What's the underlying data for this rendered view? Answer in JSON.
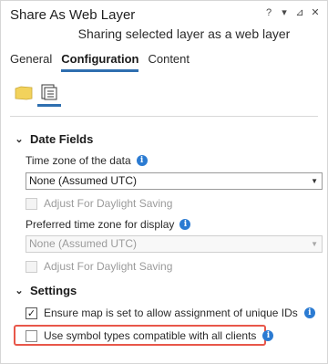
{
  "window": {
    "title": "Share As Web Layer",
    "help": "?",
    "pin": "▾",
    "autohide": "⊿",
    "close": "✕",
    "subtitle": "Sharing selected layer as a web layer"
  },
  "tabs": [
    {
      "label": "General",
      "active": false
    },
    {
      "label": "Configuration",
      "active": true
    },
    {
      "label": "Content",
      "active": false
    }
  ],
  "config_icons": [
    {
      "name": "layers-icon",
      "active": false
    },
    {
      "name": "configure-properties-icon",
      "active": true
    }
  ],
  "date_fields": {
    "heading": "Date Fields",
    "time_zone_label": "Time zone of the data",
    "time_zone_value": "None (Assumed UTC)",
    "adjust_dst_label": "Adjust For Daylight Saving",
    "adjust_dst_checked": false,
    "preferred_label": "Preferred time zone for display",
    "preferred_value": "None (Assumed UTC)",
    "adjust_dst2_label": "Adjust For Daylight Saving",
    "adjust_dst2_checked": false
  },
  "settings": {
    "heading": "Settings",
    "unique_ids_label": "Ensure map is set to allow assignment of unique IDs",
    "unique_ids_checked": true,
    "symbol_types_label": "Use symbol types compatible with all clients",
    "symbol_types_checked": false
  },
  "colors": {
    "accent": "#2f6fb0",
    "info": "#2b7bd2",
    "highlight": "#e8574a"
  }
}
